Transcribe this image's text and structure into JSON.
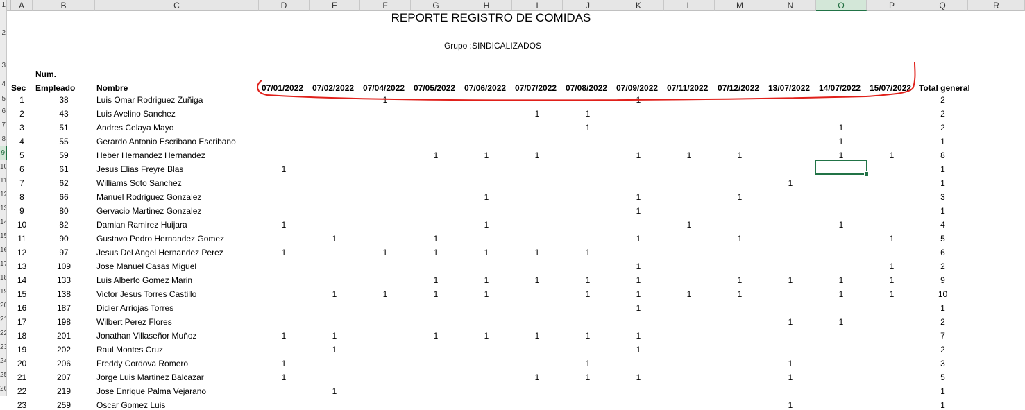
{
  "columns": [
    "A",
    "B",
    "C",
    "D",
    "E",
    "F",
    "G",
    "H",
    "I",
    "J",
    "K",
    "L",
    "M",
    "N",
    "O",
    "P",
    "Q",
    "R"
  ],
  "row_numbers": [
    "1",
    "2",
    "3",
    "4",
    "5",
    "6",
    "7",
    "8",
    "9",
    "10",
    "11",
    "12",
    "13",
    "14",
    "15",
    "16",
    "17",
    "18",
    "19",
    "20",
    "21",
    "22",
    "23",
    "24",
    "25",
    "26"
  ],
  "active_column": "O",
  "active_row": "9",
  "report": {
    "title": "REPORTE REGISTRO DE COMIDAS",
    "group": "Grupo :SINDICALIZADOS"
  },
  "headers": {
    "sec": "Sec",
    "num_line1": "Num.",
    "num_line2": "Empleado",
    "name": "Nombre",
    "dates": [
      "07/01/2022",
      "07/02/2022",
      "07/04/2022",
      "07/05/2022",
      "07/06/2022",
      "07/07/2022",
      "07/08/2022",
      "07/09/2022",
      "07/11/2022",
      "07/12/2022",
      "13/07/2022",
      "14/07/2022",
      "15/07/2022"
    ],
    "total": "Total general"
  },
  "rows": [
    {
      "sec": "1",
      "num": "38",
      "name": "Luis Omar Rodriguez Zuñiga",
      "marks": [
        "",
        "",
        "1",
        "",
        "",
        "",
        "",
        "1",
        "",
        "",
        "",
        "",
        ""
      ],
      "total": "2"
    },
    {
      "sec": "2",
      "num": "43",
      "name": "Luis Avelino Sanchez",
      "marks": [
        "",
        "",
        "",
        "",
        "",
        "1",
        "1",
        "",
        "",
        "",
        "",
        "",
        ""
      ],
      "total": "2"
    },
    {
      "sec": "3",
      "num": "51",
      "name": "Andres Celaya Mayo",
      "marks": [
        "",
        "",
        "",
        "",
        "",
        "",
        "1",
        "",
        "",
        "",
        "",
        "1",
        ""
      ],
      "total": "2"
    },
    {
      "sec": "4",
      "num": "55",
      "name": "Gerardo Antonio Escribano Escribano",
      "marks": [
        "",
        "",
        "",
        "",
        "",
        "",
        "",
        "",
        "",
        "",
        "",
        "1",
        ""
      ],
      "total": "1"
    },
    {
      "sec": "5",
      "num": "59",
      "name": "Heber Hernandez Hernandez",
      "marks": [
        "",
        "",
        "",
        "1",
        "1",
        "1",
        "",
        "1",
        "1",
        "1",
        "",
        "1",
        "1"
      ],
      "total": "8"
    },
    {
      "sec": "6",
      "num": "61",
      "name": "Jesus Elias Freyre Blas",
      "marks": [
        "1",
        "",
        "",
        "",
        "",
        "",
        "",
        "",
        "",
        "",
        "",
        "",
        ""
      ],
      "total": "1"
    },
    {
      "sec": "7",
      "num": "62",
      "name": "Williams Soto Sanchez",
      "marks": [
        "",
        "",
        "",
        "",
        "",
        "",
        "",
        "",
        "",
        "",
        "1",
        "",
        ""
      ],
      "total": "1"
    },
    {
      "sec": "8",
      "num": "66",
      "name": "Manuel Rodriguez Gonzalez",
      "marks": [
        "",
        "",
        "",
        "",
        "1",
        "",
        "",
        "1",
        "",
        "1",
        "",
        "",
        ""
      ],
      "total": "3"
    },
    {
      "sec": "9",
      "num": "80",
      "name": "Gervacio Martinez Gonzalez",
      "marks": [
        "",
        "",
        "",
        "",
        "",
        "",
        "",
        "1",
        "",
        "",
        "",
        "",
        ""
      ],
      "total": "1"
    },
    {
      "sec": "10",
      "num": "82",
      "name": "Damian Ramirez Huijara",
      "marks": [
        "1",
        "",
        "",
        "",
        "1",
        "",
        "",
        "",
        "1",
        "",
        "",
        "1",
        ""
      ],
      "total": "4"
    },
    {
      "sec": "11",
      "num": "90",
      "name": "Gustavo Pedro Hernandez Gomez",
      "marks": [
        "",
        "1",
        "",
        "1",
        "",
        "",
        "",
        "1",
        "",
        "1",
        "",
        "",
        "1"
      ],
      "total": "5"
    },
    {
      "sec": "12",
      "num": "97",
      "name": "Jesus Del Angel Hernandez Perez",
      "marks": [
        "1",
        "",
        "1",
        "1",
        "1",
        "1",
        "1",
        "",
        "",
        "",
        "",
        "",
        ""
      ],
      "total": "6"
    },
    {
      "sec": "13",
      "num": "109",
      "name": "Jose Manuel Casas Miguel",
      "marks": [
        "",
        "",
        "",
        "",
        "",
        "",
        "",
        "1",
        "",
        "",
        "",
        "",
        "1"
      ],
      "total": "2"
    },
    {
      "sec": "14",
      "num": "133",
      "name": "Luis Alberto Gomez Marin",
      "marks": [
        "",
        "",
        "",
        "1",
        "1",
        "1",
        "1",
        "1",
        "",
        "1",
        "1",
        "1",
        "1"
      ],
      "total": "9"
    },
    {
      "sec": "15",
      "num": "138",
      "name": "Victor Jesus Torres Castillo",
      "marks": [
        "",
        "1",
        "1",
        "1",
        "1",
        "",
        "1",
        "1",
        "1",
        "1",
        "",
        "1",
        "1"
      ],
      "total": "10"
    },
    {
      "sec": "16",
      "num": "187",
      "name": "Didier Arriojas Torres",
      "marks": [
        "",
        "",
        "",
        "",
        "",
        "",
        "",
        "1",
        "",
        "",
        "",
        "",
        ""
      ],
      "total": "1"
    },
    {
      "sec": "17",
      "num": "198",
      "name": "Wilbert Perez Flores",
      "marks": [
        "",
        "",
        "",
        "",
        "",
        "",
        "",
        "",
        "",
        "",
        "1",
        "1",
        ""
      ],
      "total": "2"
    },
    {
      "sec": "18",
      "num": "201",
      "name": "Jonathan Villaseñor Muñoz",
      "marks": [
        "1",
        "1",
        "",
        "1",
        "1",
        "1",
        "1",
        "1",
        "",
        "",
        "",
        "",
        ""
      ],
      "total": "7"
    },
    {
      "sec": "19",
      "num": "202",
      "name": "Raul Montes Cruz",
      "marks": [
        "",
        "1",
        "",
        "",
        "",
        "",
        "",
        "1",
        "",
        "",
        "",
        "",
        ""
      ],
      "total": "2"
    },
    {
      "sec": "20",
      "num": "206",
      "name": "Freddy Cordova Romero",
      "marks": [
        "1",
        "",
        "",
        "",
        "",
        "",
        "1",
        "",
        "",
        "",
        "1",
        "",
        ""
      ],
      "total": "3"
    },
    {
      "sec": "21",
      "num": "207",
      "name": "Jorge Luis Martinez Balcazar",
      "marks": [
        "1",
        "",
        "",
        "",
        "",
        "1",
        "1",
        "1",
        "",
        "",
        "1",
        "",
        ""
      ],
      "total": "5"
    },
    {
      "sec": "22",
      "num": "219",
      "name": "Jose Enrique Palma Vejarano",
      "marks": [
        "",
        "1",
        "",
        "",
        "",
        "",
        "",
        "",
        "",
        "",
        "",
        "",
        ""
      ],
      "total": "1"
    },
    {
      "sec": "23",
      "num": "259",
      "name": "Oscar Gomez Luis",
      "marks": [
        "",
        "",
        "",
        "",
        "",
        "",
        "",
        "",
        "",
        "",
        "1",
        "",
        ""
      ],
      "total": "1"
    }
  ],
  "colors": {
    "annotation": "#e0201a",
    "selection": "#217346",
    "header_bg": "#e6e6e6"
  }
}
